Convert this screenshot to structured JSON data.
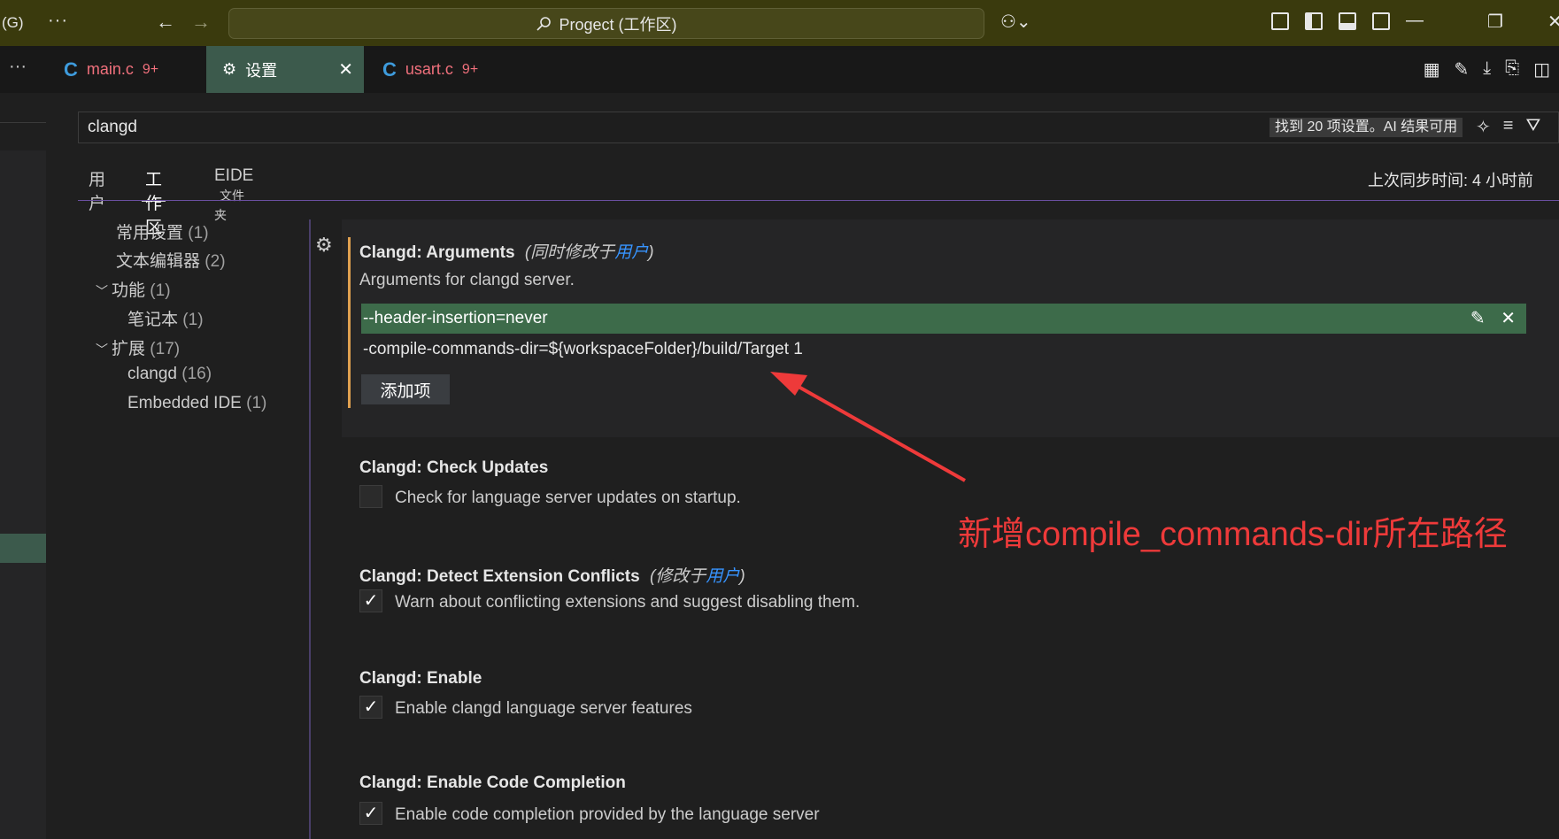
{
  "titlebar": {
    "menu_fragment": "(G)",
    "more": "···",
    "back": "←",
    "forward": "→",
    "search_text": "Progect (工作区)",
    "copilot": "⚇⌄",
    "minimize": "—",
    "restore": "❐",
    "close": "✕"
  },
  "tabs": {
    "more": "···",
    "items": [
      {
        "label": "main.c",
        "count": "9+",
        "icon": "C"
      },
      {
        "label": "设置",
        "icon": "⚙"
      },
      {
        "label": "usart.c",
        "count": "9+",
        "icon": "C"
      }
    ],
    "close": "✕"
  },
  "search": {
    "value": "clangd",
    "result": "找到 20 项设置。AI 结果可用"
  },
  "scope": {
    "user": "用户",
    "workspace": "工作区",
    "eide": "EIDE",
    "eide_sub": "文件夹",
    "sync": "上次同步时间: 4 小时前"
  },
  "toc": [
    {
      "label": "常用设置",
      "count": "(1)"
    },
    {
      "label": "文本编辑器",
      "count": "(2)"
    },
    {
      "label": "功能",
      "count": "(1)"
    },
    {
      "label": "笔记本",
      "count": "(1)"
    },
    {
      "label": "扩展",
      "count": "(17)"
    },
    {
      "label": "clangd",
      "count": "(16)"
    },
    {
      "label": "Embedded IDE",
      "count": "(1)"
    }
  ],
  "settings": {
    "arguments": {
      "title": "Clangd: Arguments",
      "modified_prefix": "(同时修改于",
      "modified_link": "用户",
      "modified_suffix": ")",
      "desc": "Arguments for clangd server.",
      "items": [
        "--header-insertion=never",
        "-compile-commands-dir=${workspaceFolder}/build/Target 1"
      ],
      "add_label": "添加项"
    },
    "check_updates": {
      "title": "Clangd: Check Updates",
      "desc": "Check for language server updates on startup.",
      "checked": ""
    },
    "detect_conflicts": {
      "title": "Clangd: Detect Extension Conflicts",
      "modified_prefix": "(修改于",
      "modified_link": "用户",
      "modified_suffix": ")",
      "desc": "Warn about conflicting extensions and suggest disabling them.",
      "checked": "✓"
    },
    "enable": {
      "title": "Clangd: Enable",
      "desc": "Enable clangd language server features",
      "checked": "✓"
    },
    "code_completion": {
      "title": "Clangd: Enable Code Completion",
      "desc": "Enable code completion provided by the language server",
      "checked": "✓"
    }
  },
  "annotation": {
    "text": "新增compile_commands-dir所在路径",
    "color": "#ee3a3a"
  },
  "colors": {
    "titlebar_bg": "#3a3a0d",
    "accent_green": "#3d6b4a",
    "link": "#3794ff",
    "modified_bar": "#e0a050"
  }
}
